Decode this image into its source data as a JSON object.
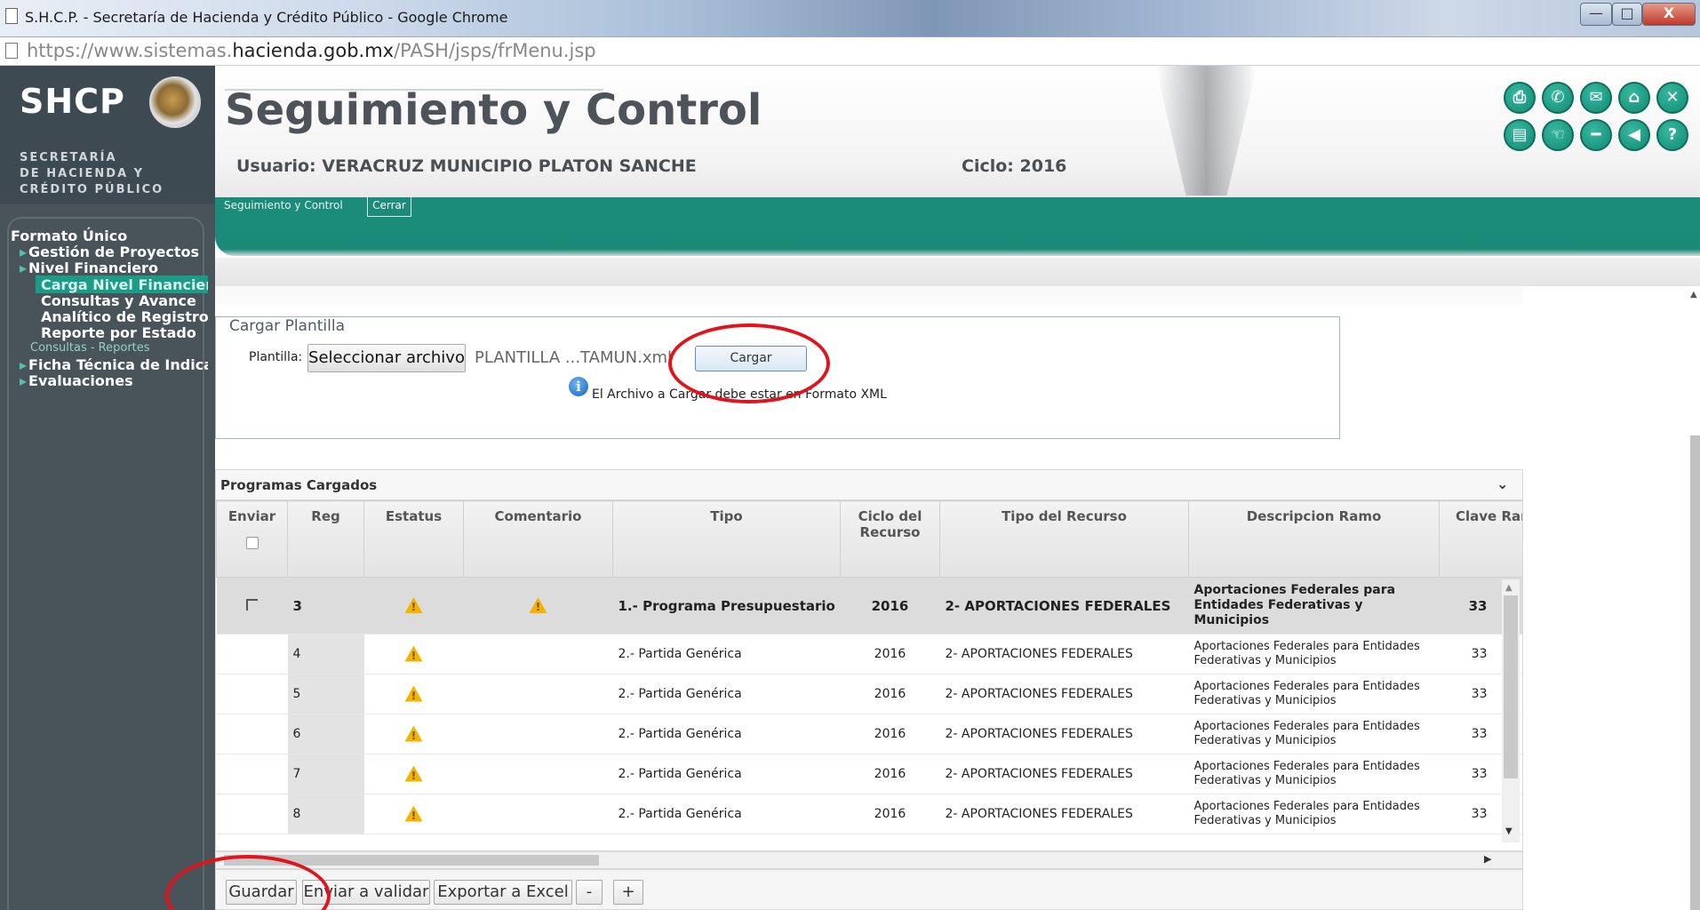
{
  "window": {
    "title": "S.H.C.P. - Secretaría de Hacienda y Crédito Público - Google Chrome",
    "min": "—",
    "max": "□",
    "close": "X"
  },
  "address": {
    "prefix": "https://www.sistemas.",
    "domain": "hacienda.gob.mx",
    "path": "/PASH/jsps/frMenu.jsp"
  },
  "logo": {
    "brand": "SHCP",
    "line1": "SECRETARÍA",
    "line2": "DE HACIENDA Y",
    "line3": "CRÉDITO PÚBLICO"
  },
  "header": {
    "title": "Seguimiento y Control",
    "usuario": "Usuario: VERACRUZ MUNICIPIO PLATON SANCHE",
    "ciclo": "Ciclo: 2016"
  },
  "tabs": {
    "seguimiento": "Seguimiento y Control",
    "cerrar": "Cerrar"
  },
  "sidebar": {
    "formato": "Formato Único",
    "gestion": "Gestión de Proyectos",
    "nivel": "Nivel Financiero",
    "carga": "Carga Nivel Financiero",
    "consultas_avance": "Consultas y Avance",
    "analitico": "Analítico de Registro",
    "reporte": "Reporte por Estado",
    "consultas_reportes": "Consultas - Reportes",
    "ficha": "Ficha Técnica de Indicadores",
    "evaluaciones": "Evaluaciones"
  },
  "cargar": {
    "legend": "Cargar Plantilla",
    "label": "Plantilla:",
    "select_btn": "Seleccionar archivo",
    "file_name": "PLANTILLA ...TAMUN.xml",
    "cargar_btn": "Cargar",
    "info": "El Archivo a Cargar debe estar en Formato XML"
  },
  "grid": {
    "title": "Programas Cargados",
    "columns": [
      "Enviar",
      "Reg",
      "Estatus",
      "Comentario",
      "Tipo",
      "Ciclo del Recurso",
      "Tipo del Recurso",
      "Descripcion Ramo",
      "Clave Ramo"
    ],
    "rows": [
      {
        "reg": "3",
        "tipo": "1.- Programa Presupuestario",
        "ciclo": "2016",
        "tipo_recurso": "2- APORTACIONES FEDERALES",
        "desc": "Aportaciones Federales para Entidades Federativas y Municipios",
        "clave": "33"
      },
      {
        "reg": "4",
        "tipo": "2.- Partida Genérica",
        "ciclo": "2016",
        "tipo_recurso": "2- APORTACIONES FEDERALES",
        "desc": "Aportaciones Federales para Entidades Federativas y Municipios",
        "clave": "33"
      },
      {
        "reg": "5",
        "tipo": "2.- Partida Genérica",
        "ciclo": "2016",
        "tipo_recurso": "2- APORTACIONES FEDERALES",
        "desc": "Aportaciones Federales para Entidades Federativas y Municipios",
        "clave": "33"
      },
      {
        "reg": "6",
        "tipo": "2.- Partida Genérica",
        "ciclo": "2016",
        "tipo_recurso": "2- APORTACIONES FEDERALES",
        "desc": "Aportaciones Federales para Entidades Federativas y Municipios",
        "clave": "33"
      },
      {
        "reg": "7",
        "tipo": "2.- Partida Genérica",
        "ciclo": "2016",
        "tipo_recurso": "2- APORTACIONES FEDERALES",
        "desc": "Aportaciones Federales para Entidades Federativas y Municipios",
        "clave": "33"
      },
      {
        "reg": "8",
        "tipo": "2.- Partida Genérica",
        "ciclo": "2016",
        "tipo_recurso": "2- APORTACIONES FEDERALES",
        "desc": "Aportaciones Federales para Entidades Federativas y Municipios",
        "clave": "33"
      }
    ]
  },
  "footer": {
    "guardar": "Guardar",
    "enviar": "Enviar a validar",
    "exportar": "Exportar a Excel",
    "minus": "-",
    "plus": "+"
  },
  "toolbar_icons": [
    "print-icon",
    "phone-icon",
    "mail-icon",
    "home-icon",
    "close-icon",
    "clipboard-icon",
    "back-pointer-icon",
    "minus-icon",
    "left-arrow-icon",
    "help-icon"
  ]
}
